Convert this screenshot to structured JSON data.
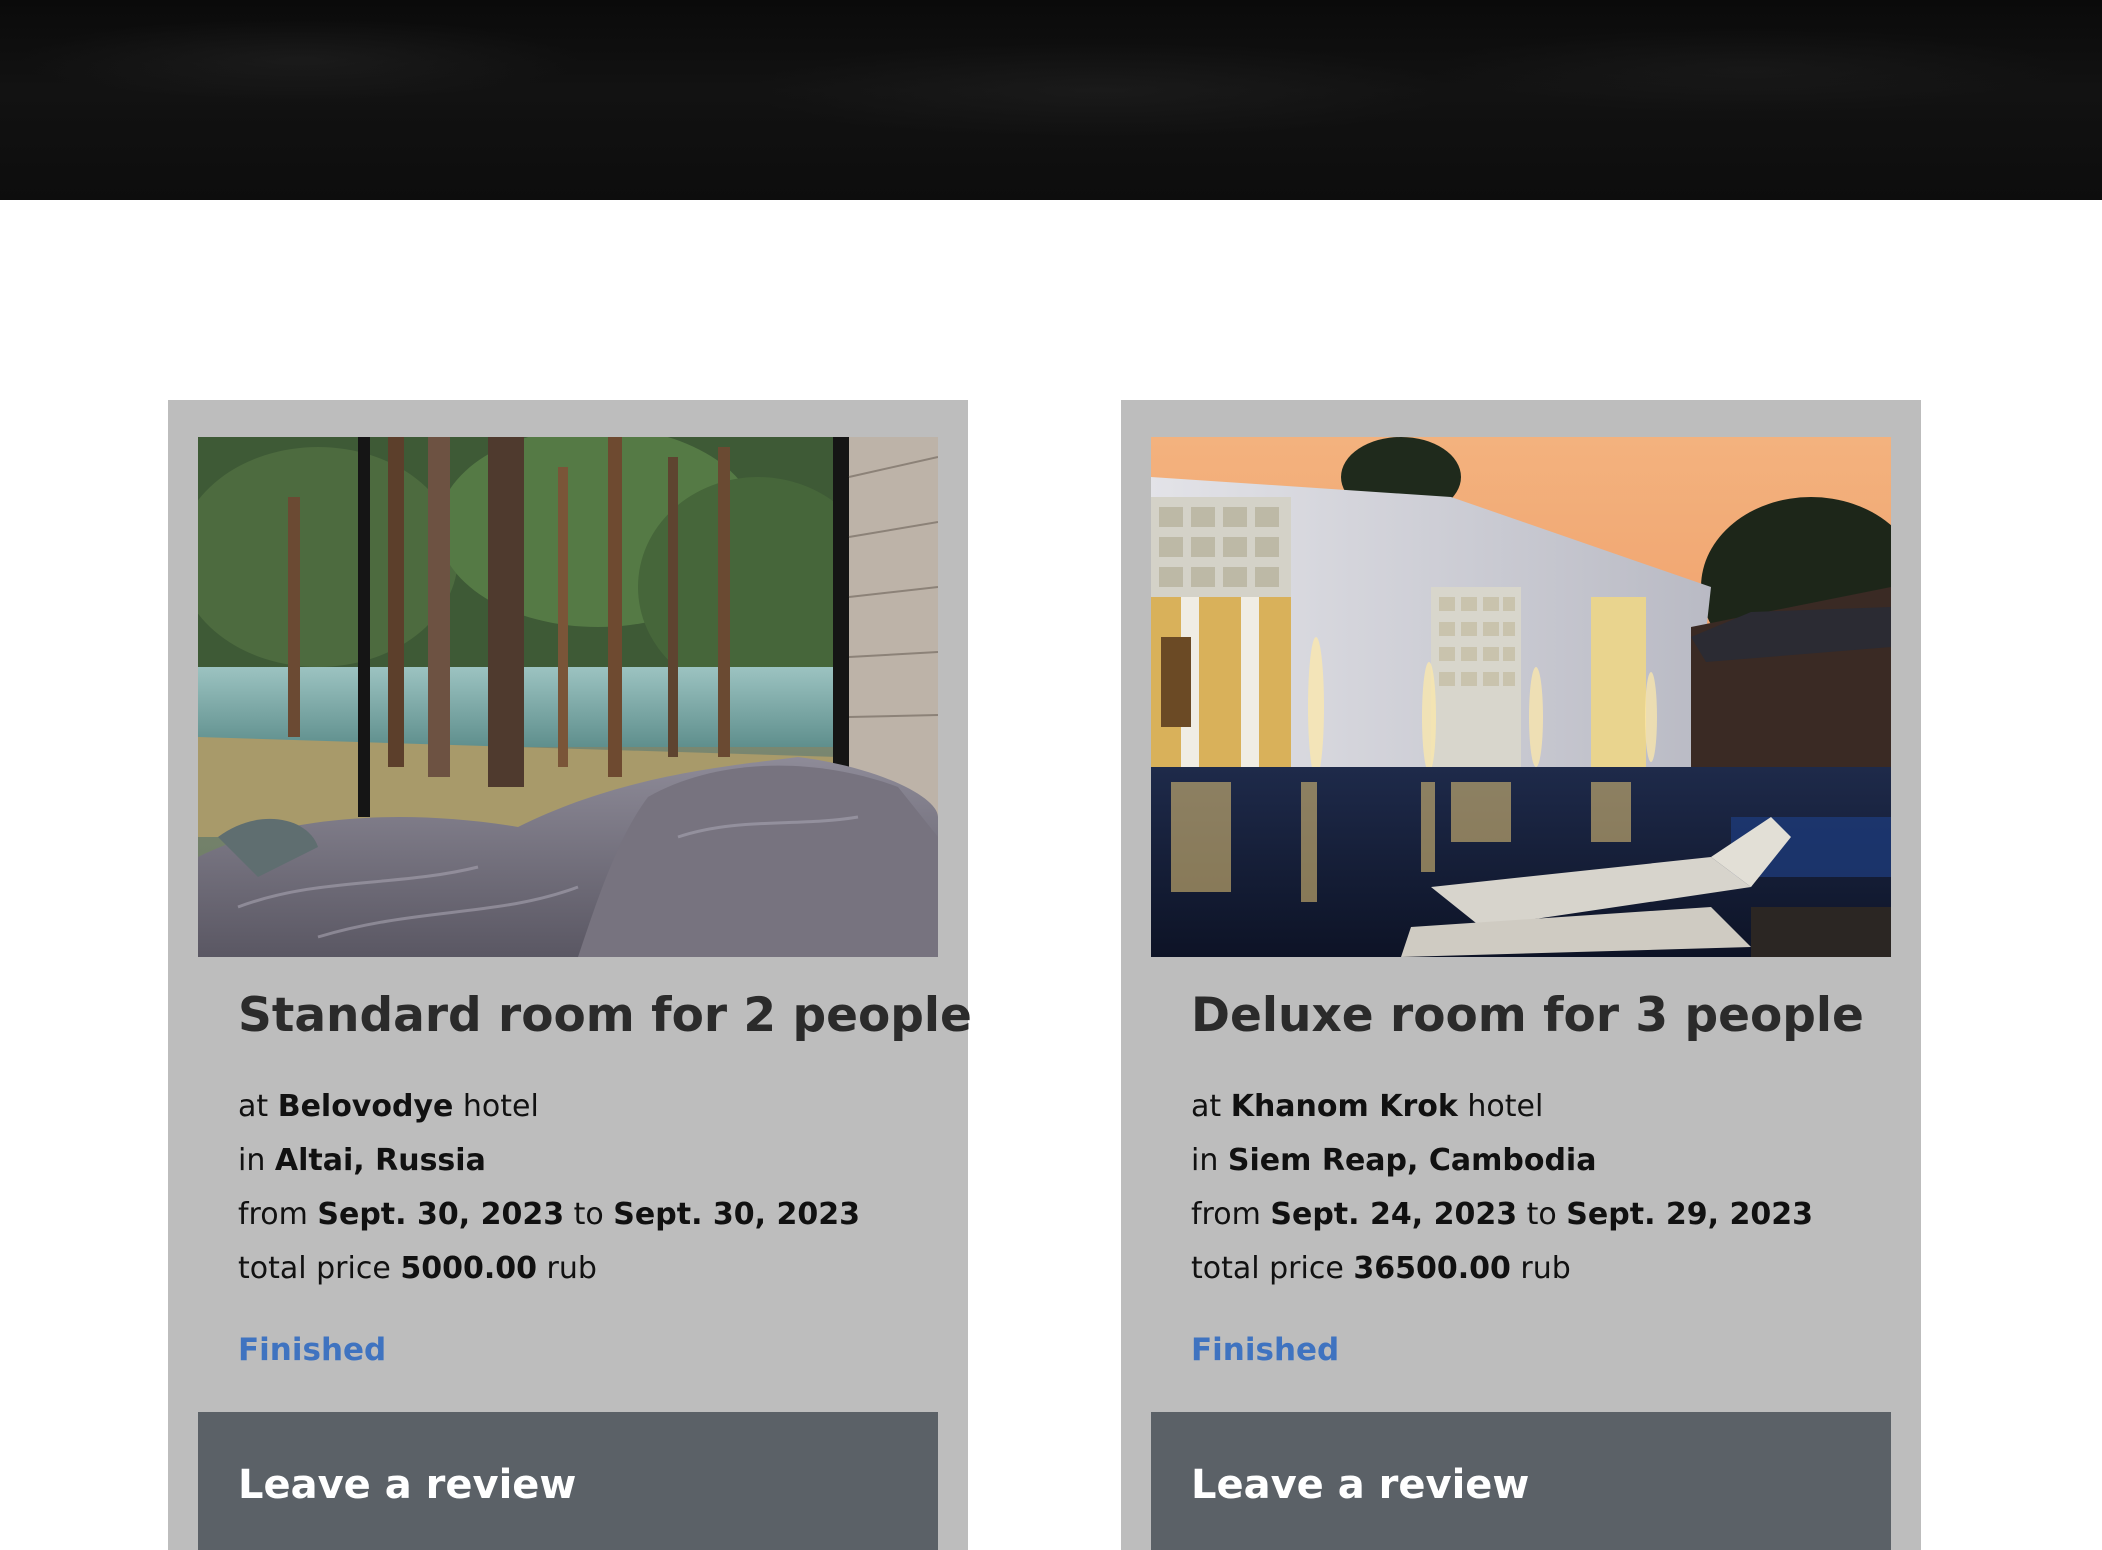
{
  "bookings": [
    {
      "room_title": "Standard room for 2 people",
      "at_prefix": "at",
      "hotel": "Belovodye",
      "hotel_suffix": "hotel",
      "in_prefix": "in",
      "location": "Altai, Russia",
      "from_prefix": "from",
      "date_from": "Sept. 30, 2023",
      "to_word": "to",
      "date_to": "Sept. 30, 2023",
      "price_prefix": "total price",
      "price": "5000.00",
      "currency": "rub",
      "status": "Finished",
      "review_label": "Leave a review"
    },
    {
      "room_title": "Deluxe room for 3 people",
      "at_prefix": "at",
      "hotel": "Khanom Krok",
      "hotel_suffix": "hotel",
      "in_prefix": "in",
      "location": "Siem Reap, Cambodia",
      "from_prefix": "from",
      "date_from": "Sept. 24, 2023",
      "to_word": "to",
      "date_to": "Sept. 29, 2023",
      "price_prefix": "total price",
      "price": "36500.00",
      "currency": "rub",
      "status": "Finished",
      "review_label": "Leave a review"
    }
  ],
  "colors": {
    "card_bg": "#bdbdbd",
    "status": "#3f73c0",
    "review_button": "#5b6167",
    "hero_bg": "#0d0d0d"
  }
}
